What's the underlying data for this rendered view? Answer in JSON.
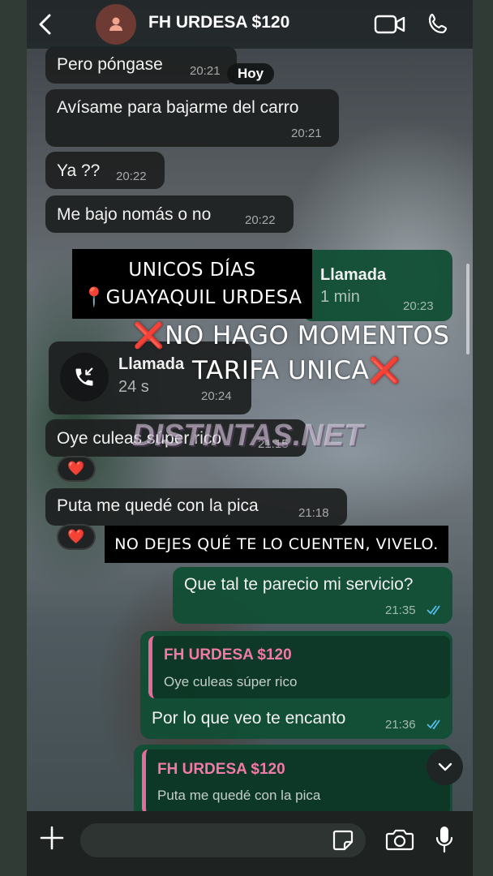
{
  "header": {
    "contact_name": "FH URDESA $120"
  },
  "date_separator": "Hoy",
  "messages": [
    {
      "text": "Pero póngase",
      "time": "20:21"
    },
    {
      "text": "Avísame para bajarme del carro",
      "time": "20:21"
    },
    {
      "text": "Ya ??",
      "time": "20:22"
    },
    {
      "text": "Me bajo nomás o no",
      "time": "20:22"
    }
  ],
  "outgoing_call": {
    "label": "Llamada",
    "duration": "1 min",
    "time": "20:23"
  },
  "incoming_call": {
    "label": "Llamada",
    "duration": "24 s",
    "time": "20:24"
  },
  "messages2": [
    {
      "text": "Oye culeas súper rico",
      "time": "21:15",
      "reaction": "❤️"
    },
    {
      "text": "Puta me quedé con la pica",
      "time": "21:18",
      "reaction": "❤️"
    }
  ],
  "outgoing": [
    {
      "text": "Que tal te parecio mi servicio?",
      "time": "21:35"
    },
    {
      "reply_name": "FH URDESA $120",
      "reply_text": "Oye culeas súper rico",
      "text": "Por lo que veo te encanto",
      "time": "21:36"
    },
    {
      "reply_name": "FH URDESA $120",
      "reply_text": "Puta me quedé con la pica"
    }
  ],
  "overlays": {
    "box1_line1": "UNICOS DÍAS",
    "box1_line2": "📍GUAYAQUIL URDESA",
    "big_line1": "❌NO HAGO MOMENTOS",
    "big_line2": "TARIFA UNICA❌",
    "watermark": "DISTINTAS.NET",
    "box2": "NO DEJES QUÉ TE LO CUENTEN, VIVELO."
  },
  "composer": {
    "placeholder": ""
  },
  "colors": {
    "outgoing_bubble": "#114e35",
    "incoming_bubble": "#1e2020",
    "reply_accent": "#f17aa6",
    "read_ticks": "#53bdeb"
  }
}
